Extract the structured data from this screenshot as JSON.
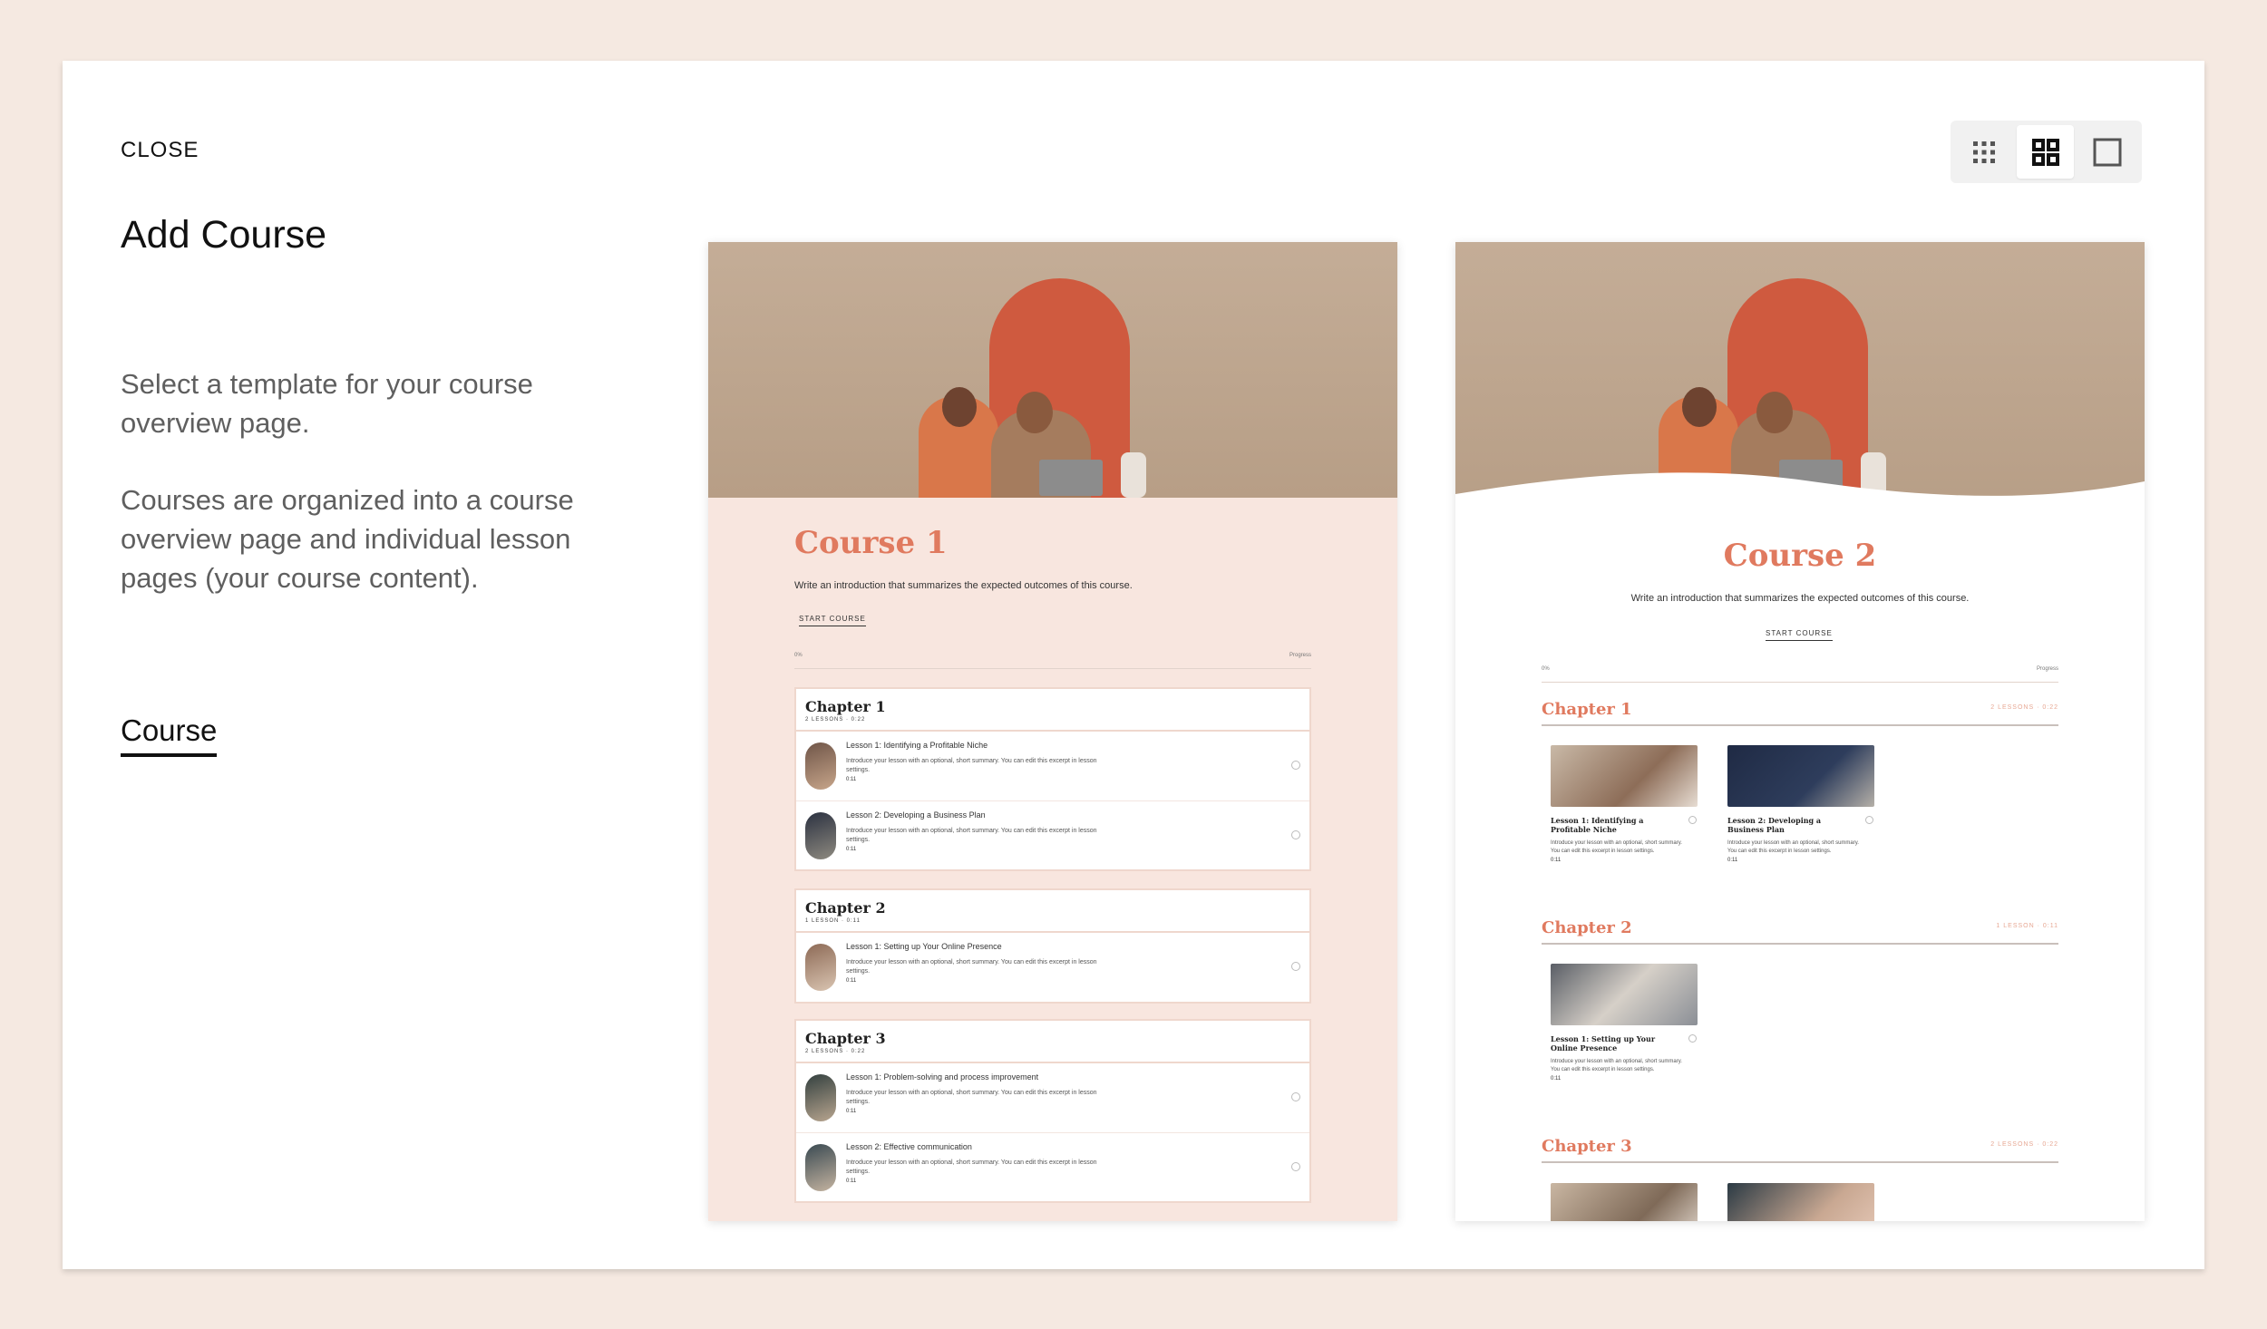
{
  "modal": {
    "close_label": "CLOSE",
    "title": "Add Course",
    "description_1": "Select a template for your course overview page.",
    "description_2": "Courses are organized into a course overview page and individual lesson pages (your course content).",
    "tab_label": "Course"
  },
  "view_toggle": {
    "icons": [
      "grid-small-icon",
      "grid-large-icon",
      "single-view-icon"
    ],
    "active": "grid-large-icon"
  },
  "templates": [
    {
      "course_title": "Course 1",
      "intro": "Write an introduction that summarizes the expected outcomes of this course.",
      "start_label": "START COURSE",
      "progress_left": "0%",
      "progress_right": "Progress",
      "chapters": [
        {
          "name": "Chapter 1",
          "meta": "2 LESSONS · 0:22",
          "lessons": [
            {
              "name": "Lesson 1: Identifying a Profitable Niche",
              "desc": "Introduce your lesson with an optional, short summary. You can edit this excerpt in lesson settings.",
              "time": "0:11"
            },
            {
              "name": "Lesson 2: Developing a Business Plan",
              "desc": "Introduce your lesson with an optional, short summary. You can edit this excerpt in lesson settings.",
              "time": "0:11"
            }
          ]
        },
        {
          "name": "Chapter 2",
          "meta": "1 LESSON · 0:11",
          "lessons": [
            {
              "name": "Lesson 1: Setting up Your Online Presence",
              "desc": "Introduce your lesson with an optional, short summary. You can edit this excerpt in lesson settings.",
              "time": "0:11"
            }
          ]
        },
        {
          "name": "Chapter 3",
          "meta": "2 LESSONS · 0:22",
          "lessons": [
            {
              "name": "Lesson 1: Problem-solving and process improvement",
              "desc": "Introduce your lesson with an optional, short summary. You can edit this excerpt in lesson settings.",
              "time": "0:11"
            },
            {
              "name": "Lesson 2: Effective communication",
              "desc": "Introduce your lesson with an optional, short summary. You can edit this excerpt in lesson settings.",
              "time": "0:11"
            }
          ]
        }
      ]
    },
    {
      "course_title": "Course 2",
      "intro": "Write an introduction that summarizes the expected outcomes of this course.",
      "start_label": "START COURSE",
      "progress_left": "0%",
      "progress_right": "Progress",
      "chapters": [
        {
          "name": "Chapter 1",
          "meta": "2 LESSONS · 0:22",
          "lessons": [
            {
              "name": "Lesson 1: Identifying a Profitable Niche",
              "desc": "Introduce your lesson with an optional, short summary. You can edit this excerpt in lesson settings.",
              "time": "0:11"
            },
            {
              "name": "Lesson 2: Developing a Business Plan",
              "desc": "Introduce your lesson with an optional, short summary. You can edit this excerpt in lesson settings.",
              "time": "0:11"
            }
          ]
        },
        {
          "name": "Chapter 2",
          "meta": "1 LESSON · 0:11",
          "lessons": [
            {
              "name": "Lesson 1: Setting up Your Online Presence",
              "desc": "Introduce your lesson with an optional, short summary. You can edit this excerpt in lesson settings.",
              "time": "0:11"
            }
          ]
        },
        {
          "name": "Chapter 3",
          "meta": "2 LESSONS · 0:22",
          "lessons": []
        }
      ]
    }
  ],
  "colors": {
    "page_bg": "#f5e9e1",
    "accent": "#e07a5f",
    "card1_bg": "#f8e6df"
  }
}
